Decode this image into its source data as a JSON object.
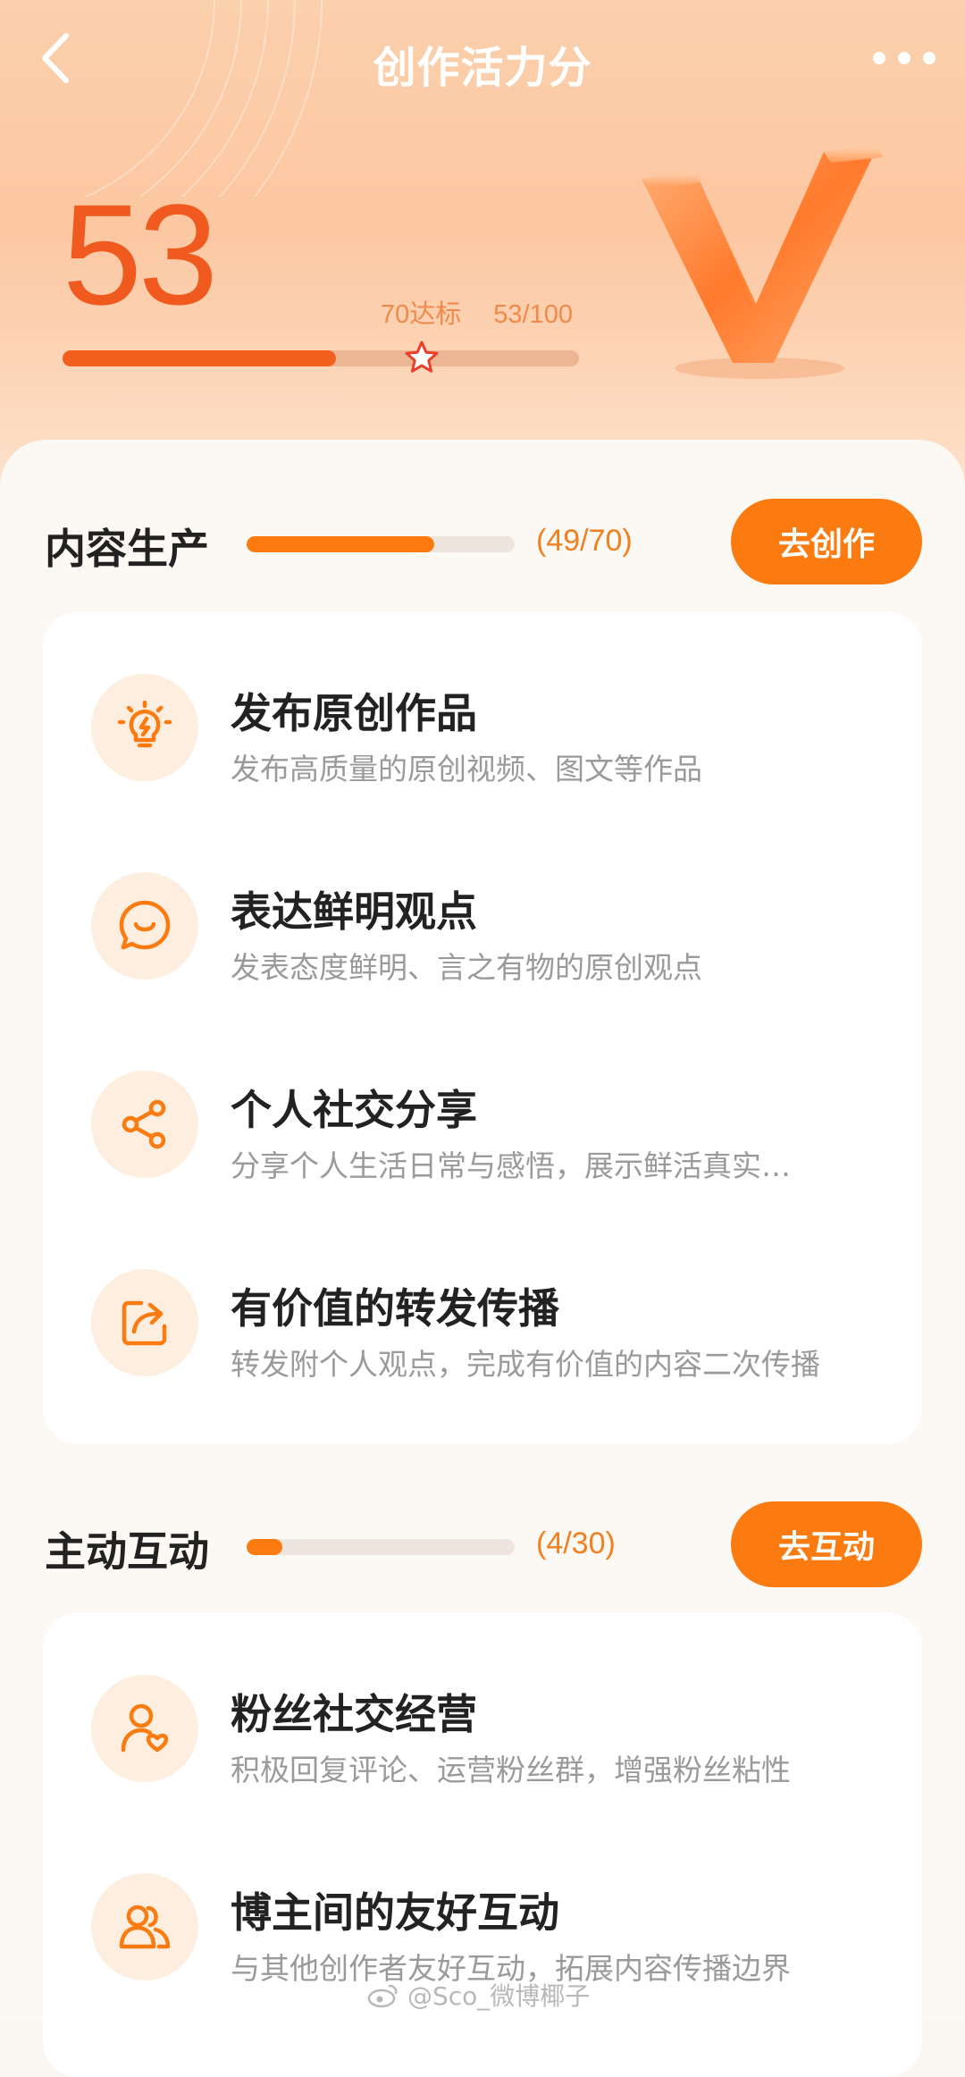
{
  "header": {
    "title": "创作活力分"
  },
  "score": {
    "value": "53",
    "target_label": "70达标",
    "progress_label": "53/100",
    "progress": 0.53,
    "target": 0.7
  },
  "sections": [
    {
      "title": "内容生产",
      "progress_text": "(49/70)",
      "progress": 0.7,
      "button_label": "去创作",
      "items": [
        {
          "icon": "lightbulb-icon",
          "title": "发布原创作品",
          "desc": "发布高质量的原创视频、图文等作品"
        },
        {
          "icon": "smile-chat-icon",
          "title": "表达鲜明观点",
          "desc": "发表态度鲜明、言之有物的原创观点"
        },
        {
          "icon": "share-icon",
          "title": "个人社交分享",
          "desc": "分享个人生活日常与感悟，展示鲜活真实…"
        },
        {
          "icon": "repost-icon",
          "title": "有价值的转发传播",
          "desc": "转发附个人观点，完成有价值的内容二次传播"
        }
      ]
    },
    {
      "title": "主动互动",
      "progress_text": "(4/30)",
      "progress": 0.133,
      "button_label": "去互动",
      "items": [
        {
          "icon": "user-heart-icon",
          "title": "粉丝社交经营",
          "desc": "积极回复评论、运营粉丝群，增强粉丝粘性"
        },
        {
          "icon": "users-icon",
          "title": "博主间的友好互动",
          "desc": "与其他创作者友好互动，拓展内容传播边界"
        }
      ]
    }
  ],
  "watermark": "@Sco_微博椰子",
  "colors": {
    "accent": "#fb7b10",
    "score": "#f05a1e",
    "icon_bg": "#fdeedf"
  }
}
